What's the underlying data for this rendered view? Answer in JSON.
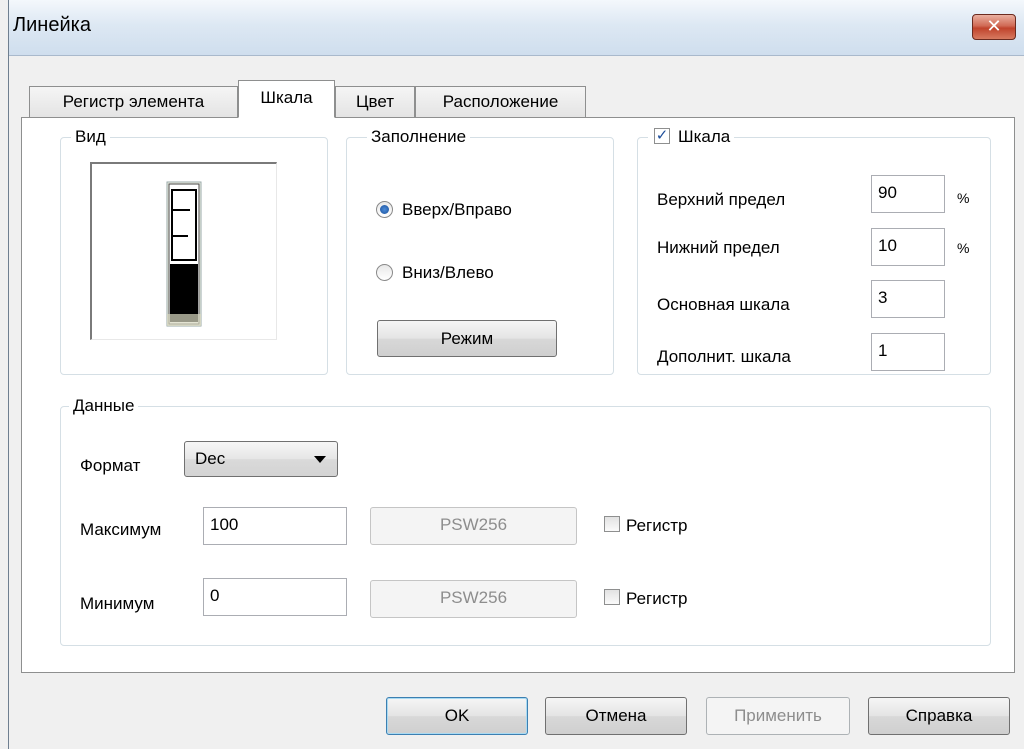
{
  "window": {
    "title": "Линейка",
    "close_glyph": "✕"
  },
  "tabs": [
    {
      "label": "Регистр элемента"
    },
    {
      "label": "Шкала"
    },
    {
      "label": "Цвет"
    },
    {
      "label": "Расположение"
    }
  ],
  "view_group": {
    "legend": "Вид"
  },
  "fill_group": {
    "legend": "Заполнение",
    "options": [
      {
        "label": "Вверх/Вправо",
        "selected": true
      },
      {
        "label": "Вниз/Влево",
        "selected": false
      }
    ],
    "mode_button": "Режим"
  },
  "scale_group": {
    "legend": "Шкала",
    "checked": true,
    "check_glyph": "✓",
    "upper_limit_label": "Верхний предел",
    "upper_limit_value": "90",
    "upper_unit": "%",
    "lower_limit_label": "Нижний предел",
    "lower_limit_value": "10",
    "lower_unit": "%",
    "main_scale_label": "Основная шкала",
    "main_scale_value": "3",
    "sub_scale_label": "Дополнит.  шкала",
    "sub_scale_value": "1"
  },
  "data_group": {
    "legend": "Данные",
    "format_label": "Формат",
    "format_value": "Dec",
    "max_label": "Максимум",
    "max_value": "100",
    "max_register_field": "PSW256",
    "max_register_label": "Регистр",
    "min_label": "Минимум",
    "min_value": "0",
    "min_register_field": "PSW256",
    "min_register_label": "Регистр"
  },
  "buttons": {
    "ok": "OK",
    "cancel": "Отмена",
    "apply": "Применить",
    "help": "Справка"
  },
  "icons": {
    "radio_checked": "radio-checked-icon",
    "close": "close-icon",
    "dropdown": "chevron-down-icon"
  }
}
